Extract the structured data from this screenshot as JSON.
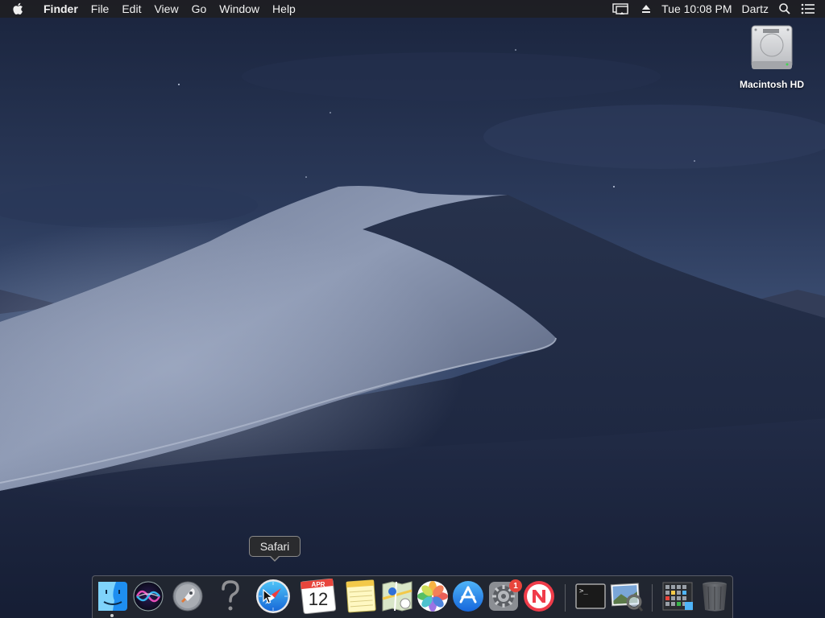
{
  "menubar": {
    "app_name": "Finder",
    "menus": [
      "File",
      "Edit",
      "View",
      "Go",
      "Window",
      "Help"
    ],
    "clock": "Tue 10:08 PM",
    "user": "Dartz"
  },
  "desktop": {
    "drive_label": "Macintosh HD"
  },
  "tooltip": {
    "text": "Safari"
  },
  "dock": {
    "calendar_month": "APR",
    "calendar_day": "12",
    "system_prefs_badge": "1",
    "terminal_prompt": ">_",
    "items": [
      {
        "name": "Finder",
        "icon": "finder-icon",
        "running": true
      },
      {
        "name": "Siri",
        "icon": "siri-icon"
      },
      {
        "name": "Launchpad",
        "icon": "launchpad-icon"
      },
      {
        "name": "Help",
        "icon": "question-icon"
      },
      {
        "name": "Safari",
        "icon": "safari-icon"
      },
      {
        "name": "Calendar",
        "icon": "calendar-icon"
      },
      {
        "name": "Notes",
        "icon": "notes-icon"
      },
      {
        "name": "Maps",
        "icon": "maps-icon"
      },
      {
        "name": "Photos",
        "icon": "photos-icon"
      },
      {
        "name": "App Store",
        "icon": "app-store-icon"
      },
      {
        "name": "System Preferences",
        "icon": "system-preferences-icon"
      },
      {
        "name": "News",
        "icon": "news-icon"
      },
      {
        "name": "Terminal",
        "icon": "terminal-icon"
      },
      {
        "name": "Preview",
        "icon": "preview-icon"
      },
      {
        "name": "Applications",
        "icon": "applications-folder-icon"
      },
      {
        "name": "Trash",
        "icon": "trash-icon"
      }
    ]
  },
  "colors": {
    "sky_top": "#1b2742",
    "sky_mid": "#34466a",
    "dune_light": "#8a96b0",
    "dune_dark": "#1e2940",
    "badge": "#e8453c"
  }
}
